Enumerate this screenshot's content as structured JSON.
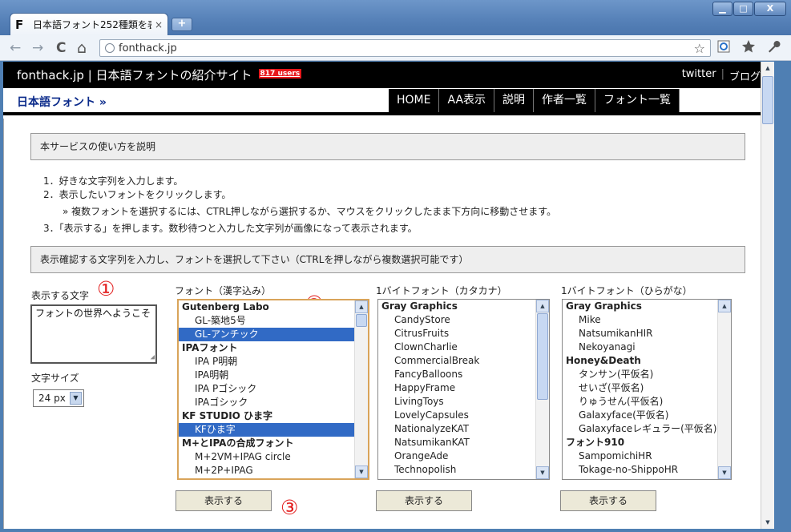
{
  "browser": {
    "tab_title": "日本語フォント252種類を表...",
    "favicon_letter": "F",
    "tab_close": "×",
    "new_tab": "+",
    "url": "fonthack.jp",
    "window_buttons": {
      "minimize": "▁",
      "maximize": "□",
      "close": "X"
    },
    "nav": {
      "back": "←",
      "forward": "→",
      "reload": "C",
      "home": "⌂"
    },
    "star": "☆"
  },
  "site": {
    "title": "fonthack.jp | 日本語フォントの紹介サイト",
    "users_badge": "817 users",
    "header_links": {
      "twitter": "twitter",
      "separator": "|",
      "blog": "ブログ"
    },
    "breadcrumb": "日本語フォント »",
    "menu": [
      "HOME",
      "AA表示",
      "説明",
      "作者一覧",
      "フォント一覧"
    ]
  },
  "help": {
    "heading": "本サービスの使い方を説明",
    "steps": [
      "1．好きな文字列を入力します。",
      "2．表示したいフォントをクリックします。",
      "» 複数フォントを選択するには、CTRL押しながら選択するか、マウスをクリックしたまま下方向に移動させます。",
      "3．「表示する」を押します。数秒待つと入力した文字列が画像になって表示されます。"
    ]
  },
  "form": {
    "heading": "表示確認する文字列を入力し、フォントを選択して下さい（CTRLを押しながら複数選択可能です）",
    "text_label": "表示する文字",
    "text_value": "フォントの世界へようこそ",
    "size_label": "文字サイズ",
    "size_value": "24 px",
    "markers": [
      "①",
      "②",
      "③"
    ],
    "columns": [
      {
        "label": "フォント（漢字込み）",
        "button": "表示する",
        "items": [
          {
            "text": "Gutenberg Labo",
            "group": true
          },
          {
            "text": "GL-築地5号"
          },
          {
            "text": "GL-アンチック",
            "selected": true
          },
          {
            "text": "IPAフォント",
            "group": true
          },
          {
            "text": "IPA P明朝"
          },
          {
            "text": "IPA明朝"
          },
          {
            "text": "IPA Pゴシック"
          },
          {
            "text": "IPAゴシック"
          },
          {
            "text": "KF STUDIO ひま字",
            "group": true
          },
          {
            "text": "KFひま字",
            "selected": true
          },
          {
            "text": "M+とIPAの合成フォント",
            "group": true
          },
          {
            "text": "M+2VM+IPAG circle"
          },
          {
            "text": "M+2P+IPAG"
          }
        ]
      },
      {
        "label": "1バイトフォント（カタカナ）",
        "button": "表示する",
        "items": [
          {
            "text": "Gray Graphics",
            "group": true
          },
          {
            "text": "CandyStore"
          },
          {
            "text": "CitrusFruits"
          },
          {
            "text": "ClownCharlie"
          },
          {
            "text": "CommercialBreak"
          },
          {
            "text": "FancyBalloons"
          },
          {
            "text": "HappyFrame"
          },
          {
            "text": "LivingToys"
          },
          {
            "text": "LovelyCapsules"
          },
          {
            "text": "NationalyzeKAT"
          },
          {
            "text": "NatsumikanKAT"
          },
          {
            "text": "OrangeAde"
          },
          {
            "text": "Technopolish"
          }
        ]
      },
      {
        "label": "1バイトフォント（ひらがな）",
        "button": "表示する",
        "items": [
          {
            "text": "Gray Graphics",
            "group": true
          },
          {
            "text": "Mike"
          },
          {
            "text": "NatsumikanHIR"
          },
          {
            "text": "Nekoyanagi"
          },
          {
            "text": "Honey&Death",
            "group": true
          },
          {
            "text": "タンサン(平仮名)"
          },
          {
            "text": "せいざ(平仮名)"
          },
          {
            "text": "りゅうせん(平仮名)"
          },
          {
            "text": "Galaxyface(平仮名)"
          },
          {
            "text": "Galaxyfaceレギュラー(平仮名)"
          },
          {
            "text": "フォント910",
            "group": true
          },
          {
            "text": "SampomichiHR"
          },
          {
            "text": "Tokage-no-ShippoHR"
          }
        ]
      }
    ]
  }
}
